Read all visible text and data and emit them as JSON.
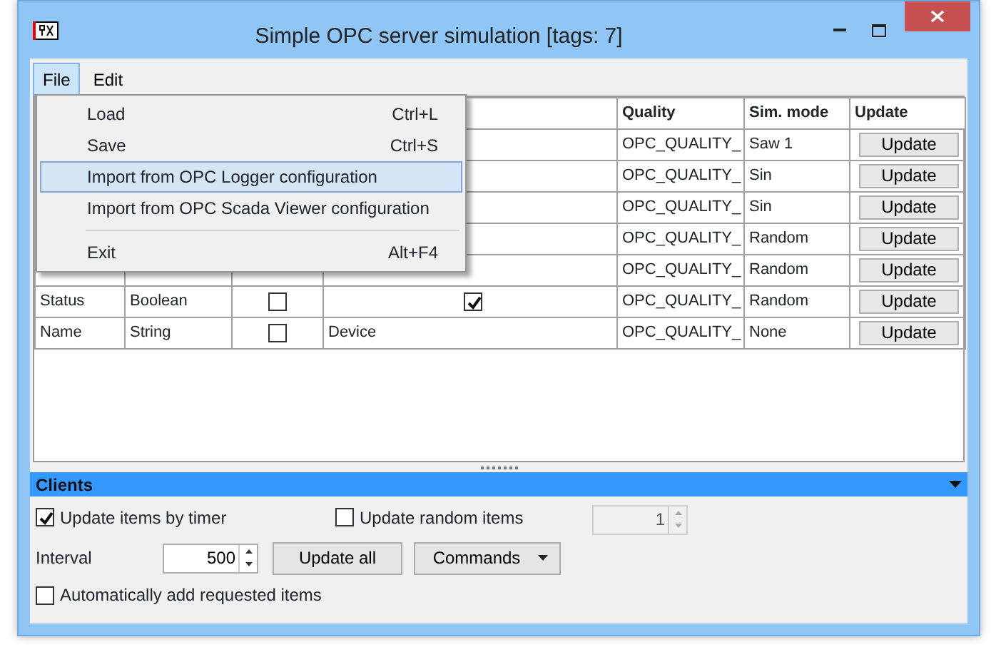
{
  "window": {
    "title": "Simple OPC server simulation [tags: 7]"
  },
  "menu_bar": [
    {
      "label": "File",
      "selected": true
    },
    {
      "label": "Edit",
      "selected": false
    }
  ],
  "file_menu": [
    {
      "kind": "item",
      "label": "Load",
      "shortcut": "Ctrl+L",
      "selected": false
    },
    {
      "kind": "item",
      "label": "Save",
      "shortcut": "Ctrl+S",
      "selected": false
    },
    {
      "kind": "item",
      "label": "Import from OPC Logger configuration",
      "selected": true
    },
    {
      "kind": "item",
      "label": "Import from OPC Scada Viewer configuration",
      "selected": false
    },
    {
      "kind": "separator"
    },
    {
      "kind": "item",
      "label": "Exit",
      "shortcut": "Alt+F4",
      "selected": false
    }
  ],
  "table": {
    "columns": [
      "Quality",
      "Sim. mode",
      "Update"
    ],
    "rows": [
      {
        "quality": "OPC_QUALITY_",
        "sim_mode": "Saw 1",
        "button": "Update"
      },
      {
        "quality": "OPC_QUALITY_",
        "sim_mode": "Sin",
        "button": "Update"
      },
      {
        "quality": "OPC_QUALITY_",
        "sim_mode": "Sin",
        "button": "Update"
      },
      {
        "quality": "OPC_QUALITY_",
        "sim_mode": "Random",
        "button": "Update"
      },
      {
        "quality": "OPC_QUALITY_",
        "sim_mode": "Random",
        "button": "Update"
      },
      {
        "name": "Status",
        "type": "Boolean",
        "flag_checked": false,
        "value": {
          "kind": "checkbox",
          "checked": true
        },
        "quality": "OPC_QUALITY_",
        "sim_mode": "Random",
        "button": "Update"
      },
      {
        "name": "Name",
        "type": "String",
        "flag_checked": false,
        "value": {
          "kind": "text",
          "text": "Device"
        },
        "quality": "OPC_QUALITY_",
        "sim_mode": "None",
        "button": "Update"
      }
    ]
  },
  "clients": {
    "title": "Clients",
    "update_by_timer": {
      "label": "Update items by timer",
      "checked": true
    },
    "update_random": {
      "label": "Update random items",
      "checked": false
    },
    "random_count": {
      "value": "1",
      "disabled": true
    },
    "interval_label": "Interval",
    "interval": {
      "value": "500",
      "disabled": false
    },
    "update_all": "Update all",
    "commands": "Commands",
    "auto_add": {
      "label": "Automatically add requested items",
      "checked": false
    }
  }
}
